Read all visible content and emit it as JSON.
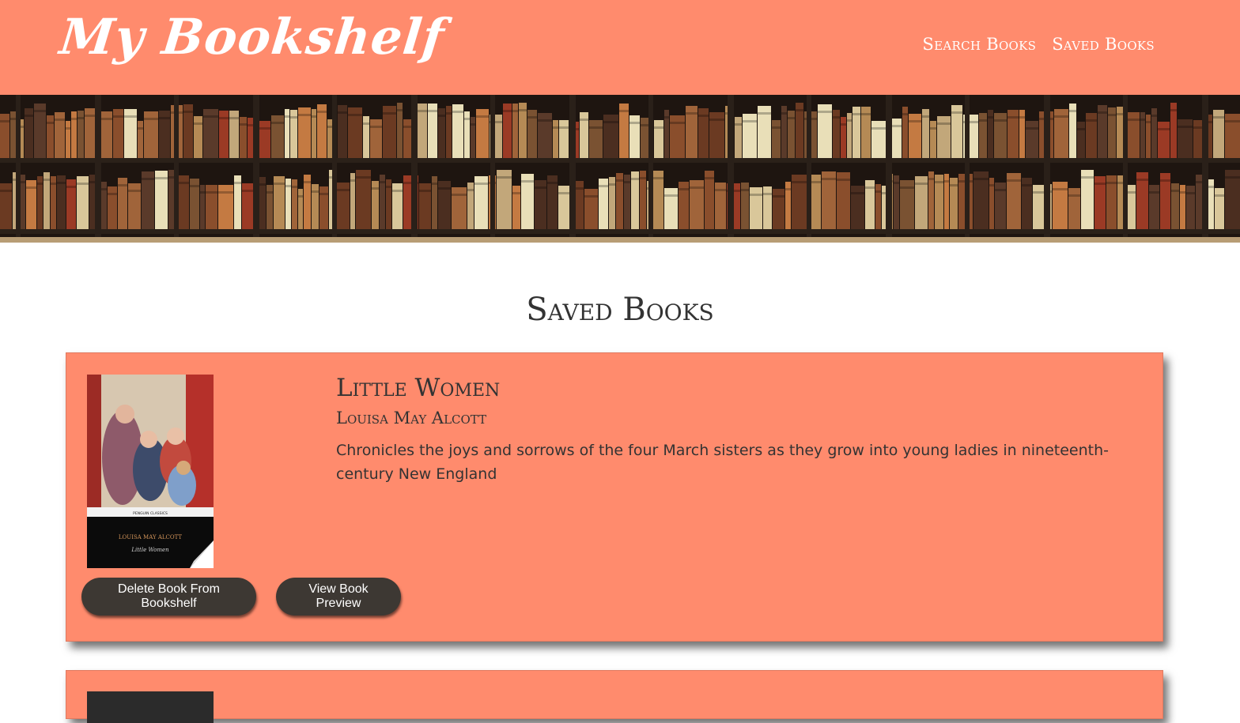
{
  "header": {
    "logo": "My Bookshelf",
    "nav": [
      {
        "label": "Search Books"
      },
      {
        "label": "Saved Books"
      }
    ]
  },
  "main": {
    "title": "Saved Books",
    "books": [
      {
        "title": "Little Women",
        "author": "Louisa May Alcott",
        "description": "Chronicles the joys and sorrows of the four March sisters as they grow into young ladies in nineteenth-century New England",
        "cover_text": {
          "author": "LOUISA MAY ALCOTT",
          "title": "Little Women",
          "series": "PENGUIN CLASSICS"
        },
        "delete_label": "Delete Book From Bookshelf",
        "preview_label": "View Book Preview"
      }
    ]
  },
  "colors": {
    "accent": "#ff8b6d",
    "button": "#3d3833",
    "text": "#333333"
  }
}
